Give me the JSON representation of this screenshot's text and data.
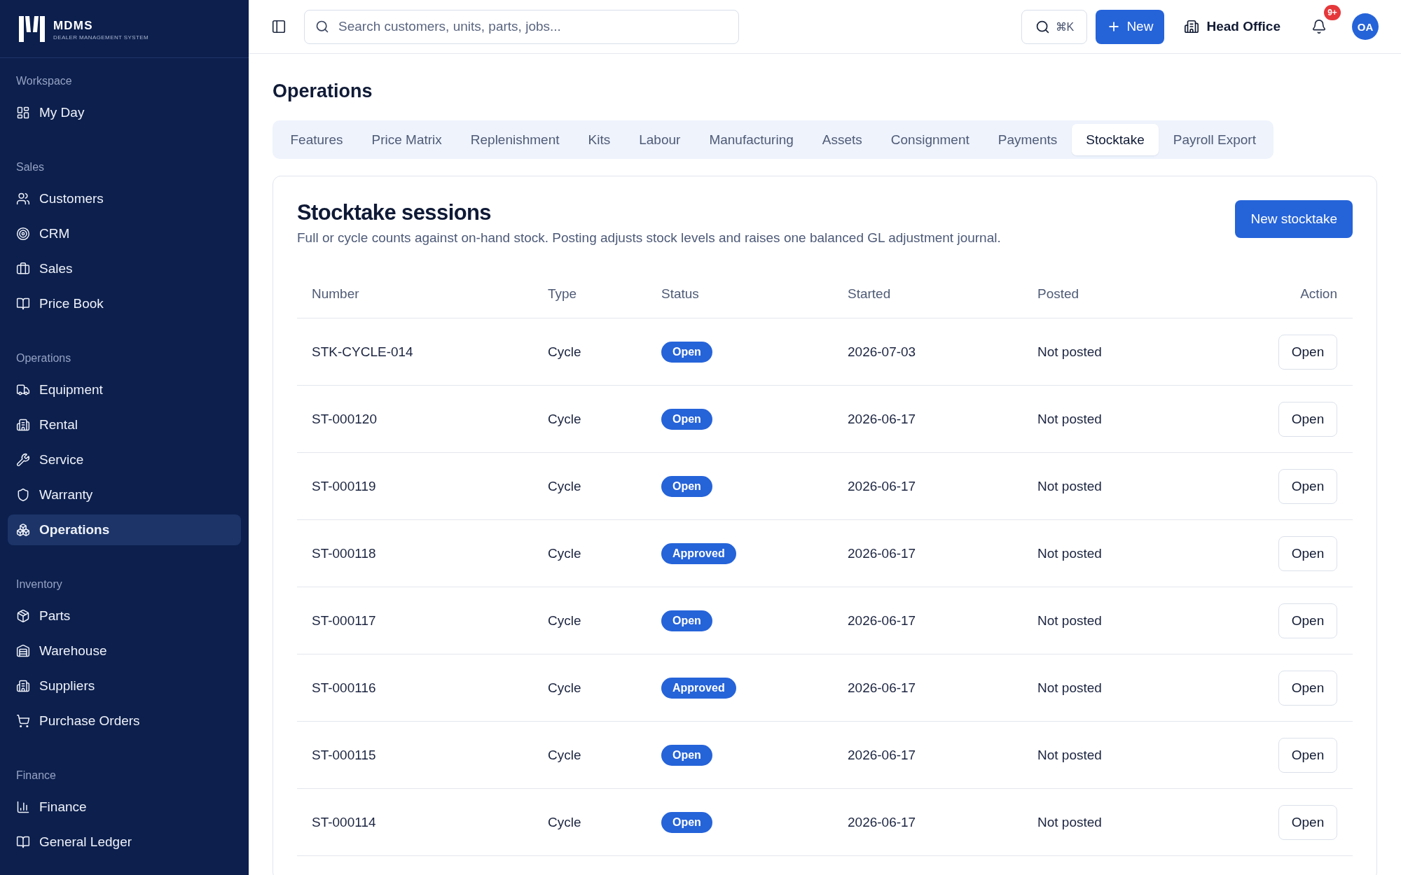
{
  "brand": {
    "name": "MDMS",
    "tagline": "DEALER MANAGEMENT SYSTEM"
  },
  "sidebar": {
    "sections": [
      {
        "label": "Workspace",
        "items": [
          {
            "label": "My Day",
            "selected": false
          }
        ]
      },
      {
        "label": "Sales",
        "items": [
          {
            "label": "Customers",
            "selected": false
          },
          {
            "label": "CRM",
            "selected": false
          },
          {
            "label": "Sales",
            "selected": false
          },
          {
            "label": "Price Book",
            "selected": false
          }
        ]
      },
      {
        "label": "Operations",
        "items": [
          {
            "label": "Equipment",
            "selected": false
          },
          {
            "label": "Rental",
            "selected": false
          },
          {
            "label": "Service",
            "selected": false
          },
          {
            "label": "Warranty",
            "selected": false
          },
          {
            "label": "Operations",
            "selected": true
          }
        ]
      },
      {
        "label": "Inventory",
        "items": [
          {
            "label": "Parts",
            "selected": false
          },
          {
            "label": "Warehouse",
            "selected": false
          },
          {
            "label": "Suppliers",
            "selected": false
          },
          {
            "label": "Purchase Orders",
            "selected": false
          }
        ]
      },
      {
        "label": "Finance",
        "items": [
          {
            "label": "Finance",
            "selected": false
          },
          {
            "label": "General Ledger",
            "selected": false
          }
        ]
      }
    ]
  },
  "topbar": {
    "search": {
      "placeholder": "Search customers, units, parts, jobs..."
    },
    "command_shortcut": "⌘K",
    "new_button": "New",
    "location": "Head Office",
    "notification_count": "9+",
    "avatar_initials": "OA"
  },
  "page": {
    "title": "Operations",
    "tabs": [
      {
        "label": "Features",
        "selected": false
      },
      {
        "label": "Price Matrix",
        "selected": false
      },
      {
        "label": "Replenishment",
        "selected": false
      },
      {
        "label": "Kits",
        "selected": false
      },
      {
        "label": "Labour",
        "selected": false
      },
      {
        "label": "Manufacturing",
        "selected": false
      },
      {
        "label": "Assets",
        "selected": false
      },
      {
        "label": "Consignment",
        "selected": false
      },
      {
        "label": "Payments",
        "selected": false
      },
      {
        "label": "Stocktake",
        "selected": true
      },
      {
        "label": "Payroll Export",
        "selected": false
      }
    ],
    "panel": {
      "title": "Stocktake sessions",
      "description": "Full or cycle counts against on-hand stock. Posting adjusts stock levels and raises one balanced GL adjustment journal.",
      "action": "New stocktake",
      "table": {
        "columns": [
          "Number",
          "Type",
          "Status",
          "Started",
          "Posted",
          "Action"
        ],
        "rows": [
          {
            "number": "STK-CYCLE-014",
            "type": "Cycle",
            "status": "Open",
            "started": "2026-07-03",
            "posted": "Not posted",
            "action": "Open"
          },
          {
            "number": "ST-000120",
            "type": "Cycle",
            "status": "Open",
            "started": "2026-06-17",
            "posted": "Not posted",
            "action": "Open"
          },
          {
            "number": "ST-000119",
            "type": "Cycle",
            "status": "Open",
            "started": "2026-06-17",
            "posted": "Not posted",
            "action": "Open"
          },
          {
            "number": "ST-000118",
            "type": "Cycle",
            "status": "Approved",
            "started": "2026-06-17",
            "posted": "Not posted",
            "action": "Open"
          },
          {
            "number": "ST-000117",
            "type": "Cycle",
            "status": "Open",
            "started": "2026-06-17",
            "posted": "Not posted",
            "action": "Open"
          },
          {
            "number": "ST-000116",
            "type": "Cycle",
            "status": "Approved",
            "started": "2026-06-17",
            "posted": "Not posted",
            "action": "Open"
          },
          {
            "number": "ST-000115",
            "type": "Cycle",
            "status": "Open",
            "started": "2026-06-17",
            "posted": "Not posted",
            "action": "Open"
          },
          {
            "number": "ST-000114",
            "type": "Cycle",
            "status": "Open",
            "started": "2026-06-17",
            "posted": "Not posted",
            "action": "Open"
          }
        ]
      }
    }
  }
}
